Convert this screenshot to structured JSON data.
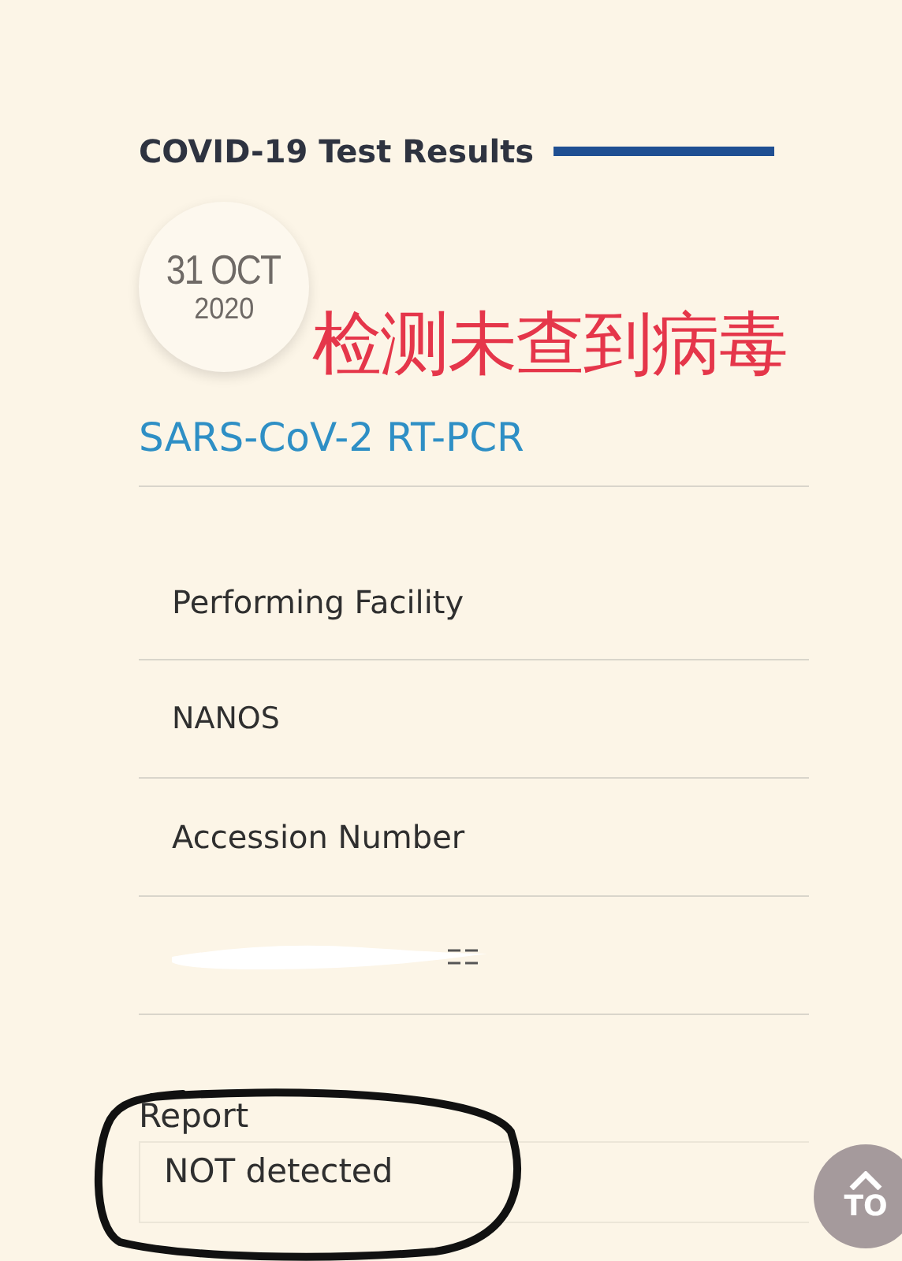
{
  "header": {
    "title": "COVID-19 Test Results"
  },
  "date": {
    "day_month": "31 OCT",
    "year": "2020"
  },
  "annotation": {
    "text": "检测未查到病毒"
  },
  "test_name": "SARS-CoV-2 RT-PCR",
  "rows": [
    {
      "kind": "label",
      "text": "Performing Facility"
    },
    {
      "kind": "value",
      "text": "NANOS"
    },
    {
      "kind": "label",
      "text": "Accession Number"
    },
    {
      "kind": "redacted"
    }
  ],
  "report": {
    "label": "Report",
    "value": "NOT detected",
    "circled": true
  },
  "top_button": {
    "label": "TO"
  }
}
